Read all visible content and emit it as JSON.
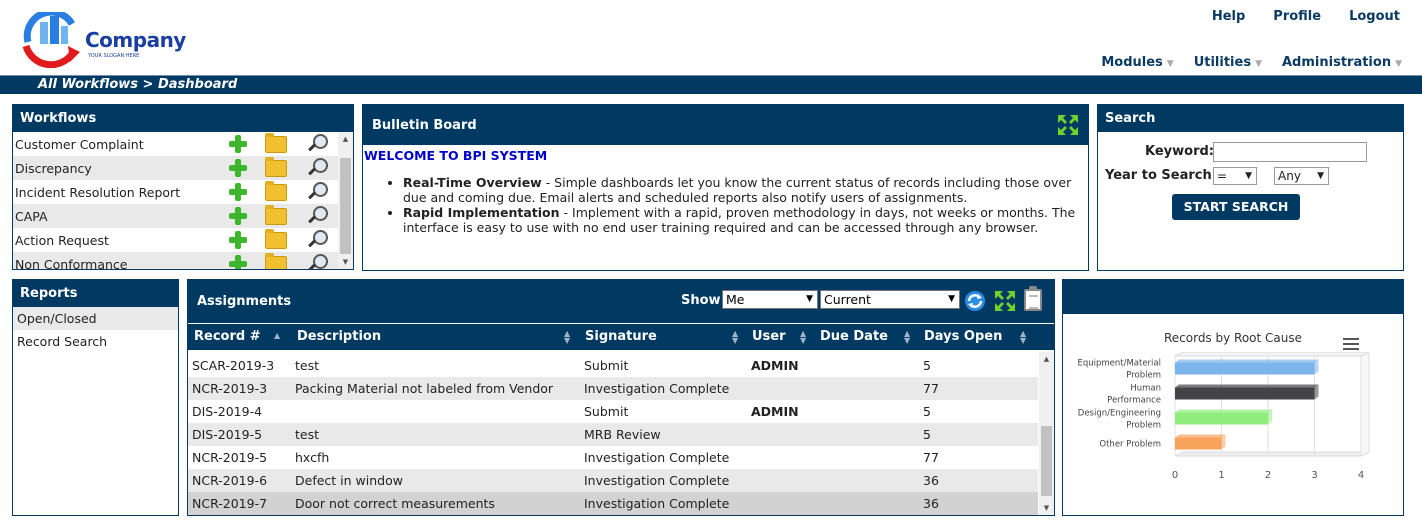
{
  "brand": {
    "name": "Company",
    "slogan": "YOUR SLOGAN HERE"
  },
  "toplinks": [
    "Help",
    "Profile",
    "Logout"
  ],
  "menu": [
    "Modules",
    "Utilities",
    "Administration"
  ],
  "breadcrumb": "All Workflows > Dashboard",
  "workflows": {
    "title": "Workflows",
    "items": [
      "Customer Complaint",
      "Discrepancy",
      "Incident Resolution Report",
      "CAPA",
      "Action Request",
      "Non Conformance"
    ]
  },
  "bulletin": {
    "title": "Bulletin Board",
    "welcome": "WELCOME TO BPI SYSTEM",
    "items": [
      {
        "bold": "Real-Time Overview",
        "text": " - Simple dashboards let you know the current status of records including those over due and coming due. Email alerts and scheduled reports also notify users of assignments."
      },
      {
        "bold": "Rapid Implementation",
        "text": " - Implement with a rapid, proven methodology in days, not weeks or months. The interface is easy to use with no end user training required and can be accessed through any browser."
      }
    ]
  },
  "search": {
    "title": "Search",
    "keyword_label": "Keyword:",
    "keyword_value": "",
    "year_label": "Year to Search:",
    "operator": "=",
    "year": "Any",
    "button": "START SEARCH"
  },
  "reports": {
    "title": "Reports",
    "items": [
      "Open/Closed",
      "Record Search"
    ]
  },
  "assignments": {
    "title": "Assignments",
    "show_label": "Show",
    "show_user": "Me",
    "show_status": "Current",
    "columns": [
      "Record #",
      "Description",
      "Signature",
      "User",
      "Due Date",
      "Days Open"
    ],
    "rows": [
      [
        "SCAR-2019-3",
        "test",
        "Submit",
        "ADMIN",
        "",
        "5"
      ],
      [
        "NCR-2019-3",
        "Packing Material not labeled from Vendor",
        "Investigation Complete",
        "",
        "",
        "77"
      ],
      [
        "DIS-2019-4",
        "",
        "Submit",
        "ADMIN",
        "",
        "5"
      ],
      [
        "DIS-2019-5",
        "test",
        "MRB Review",
        "",
        "",
        "5"
      ],
      [
        "NCR-2019-5",
        "hxcfh",
        "Investigation Complete",
        "",
        "",
        "77"
      ],
      [
        "NCR-2019-6",
        "Defect in window",
        "Investigation Complete",
        "",
        "",
        "36"
      ],
      [
        "NCR-2019-7",
        "Door not correct measurements",
        "Investigation Complete",
        "",
        "",
        "36"
      ]
    ]
  },
  "colors": {
    "primary": "#003a63",
    "green": "#3cb62c"
  },
  "chart_data": {
    "type": "bar",
    "orientation": "horizontal",
    "title": "Records by Root Cause",
    "categories": [
      "Equipment/Material Problem",
      "Human Performance",
      "Design/Engineering Problem",
      "Other Problem"
    ],
    "category_lines": [
      [
        "Equipment/Material",
        "Problem"
      ],
      [
        "Human",
        "Performance"
      ],
      [
        "Design/Engineering",
        "Problem"
      ],
      [
        "Other Problem"
      ]
    ],
    "values": [
      3,
      3,
      2,
      1
    ],
    "colors": [
      "#7cb5ec",
      "#434348",
      "#90ed7d",
      "#f7a35c"
    ],
    "xlim": [
      0,
      4
    ],
    "ticks": [
      "0",
      "1",
      "2",
      "3",
      "4"
    ],
    "grid": true
  }
}
